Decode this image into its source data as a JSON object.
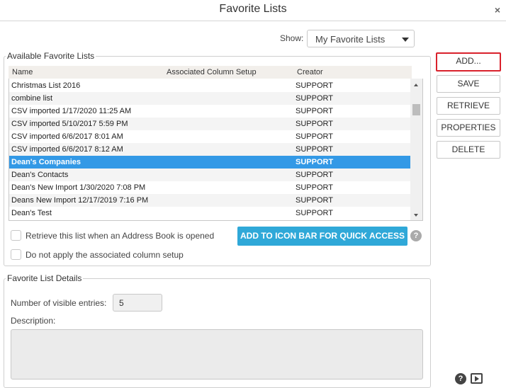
{
  "window": {
    "title": "Favorite Lists",
    "close_glyph": "×"
  },
  "show": {
    "label": "Show:",
    "selected": "My Favorite Lists"
  },
  "available": {
    "legend": "Available Favorite Lists",
    "columns": {
      "name": "Name",
      "setup": "Associated Column Setup",
      "creator": "Creator"
    },
    "rows": [
      {
        "name": "Christmas List 2016",
        "creator": "SUPPORT",
        "selected": false
      },
      {
        "name": "combine list",
        "creator": "SUPPORT",
        "selected": false
      },
      {
        "name": "CSV imported 1/17/2020 11:25 AM",
        "creator": "SUPPORT",
        "selected": false
      },
      {
        "name": "CSV imported 5/10/2017 5:59 PM",
        "creator": "SUPPORT",
        "selected": false
      },
      {
        "name": "CSV imported 6/6/2017 8:01 AM",
        "creator": "SUPPORT",
        "selected": false
      },
      {
        "name": "CSV imported 6/6/2017 8:12 AM",
        "creator": "SUPPORT",
        "selected": false
      },
      {
        "name": "Dean's Companies",
        "creator": "SUPPORT",
        "selected": true
      },
      {
        "name": "Dean's Contacts",
        "creator": "SUPPORT",
        "selected": false
      },
      {
        "name": "Dean's New Import 1/30/2020 7:08 PM",
        "creator": "SUPPORT",
        "selected": false
      },
      {
        "name": "Deans New Import 12/17/2019 7:16 PM",
        "creator": "SUPPORT",
        "selected": false
      },
      {
        "name": "Dean's Test",
        "creator": "SUPPORT",
        "selected": false
      }
    ],
    "retrieve_on_open_label": "Retrieve this list when an Address Book is opened",
    "no_column_setup_label": "Do not apply the associated column setup",
    "quick_access_button": "ADD TO ICON BAR FOR QUICK ACCESS"
  },
  "buttons": {
    "add": "ADD...",
    "save": "SAVE",
    "retrieve": "RETRIEVE",
    "properties": "PROPERTIES",
    "delete": "DELETE"
  },
  "details": {
    "legend": "Favorite List Details",
    "visible_entries_label": "Number of visible entries:",
    "visible_entries_value": "5",
    "description_label": "Description:",
    "description_value": ""
  },
  "colors": {
    "selected_row": "#3399e6",
    "quick_button": "#2fa8d8",
    "highlight_border": "#d9212c"
  }
}
